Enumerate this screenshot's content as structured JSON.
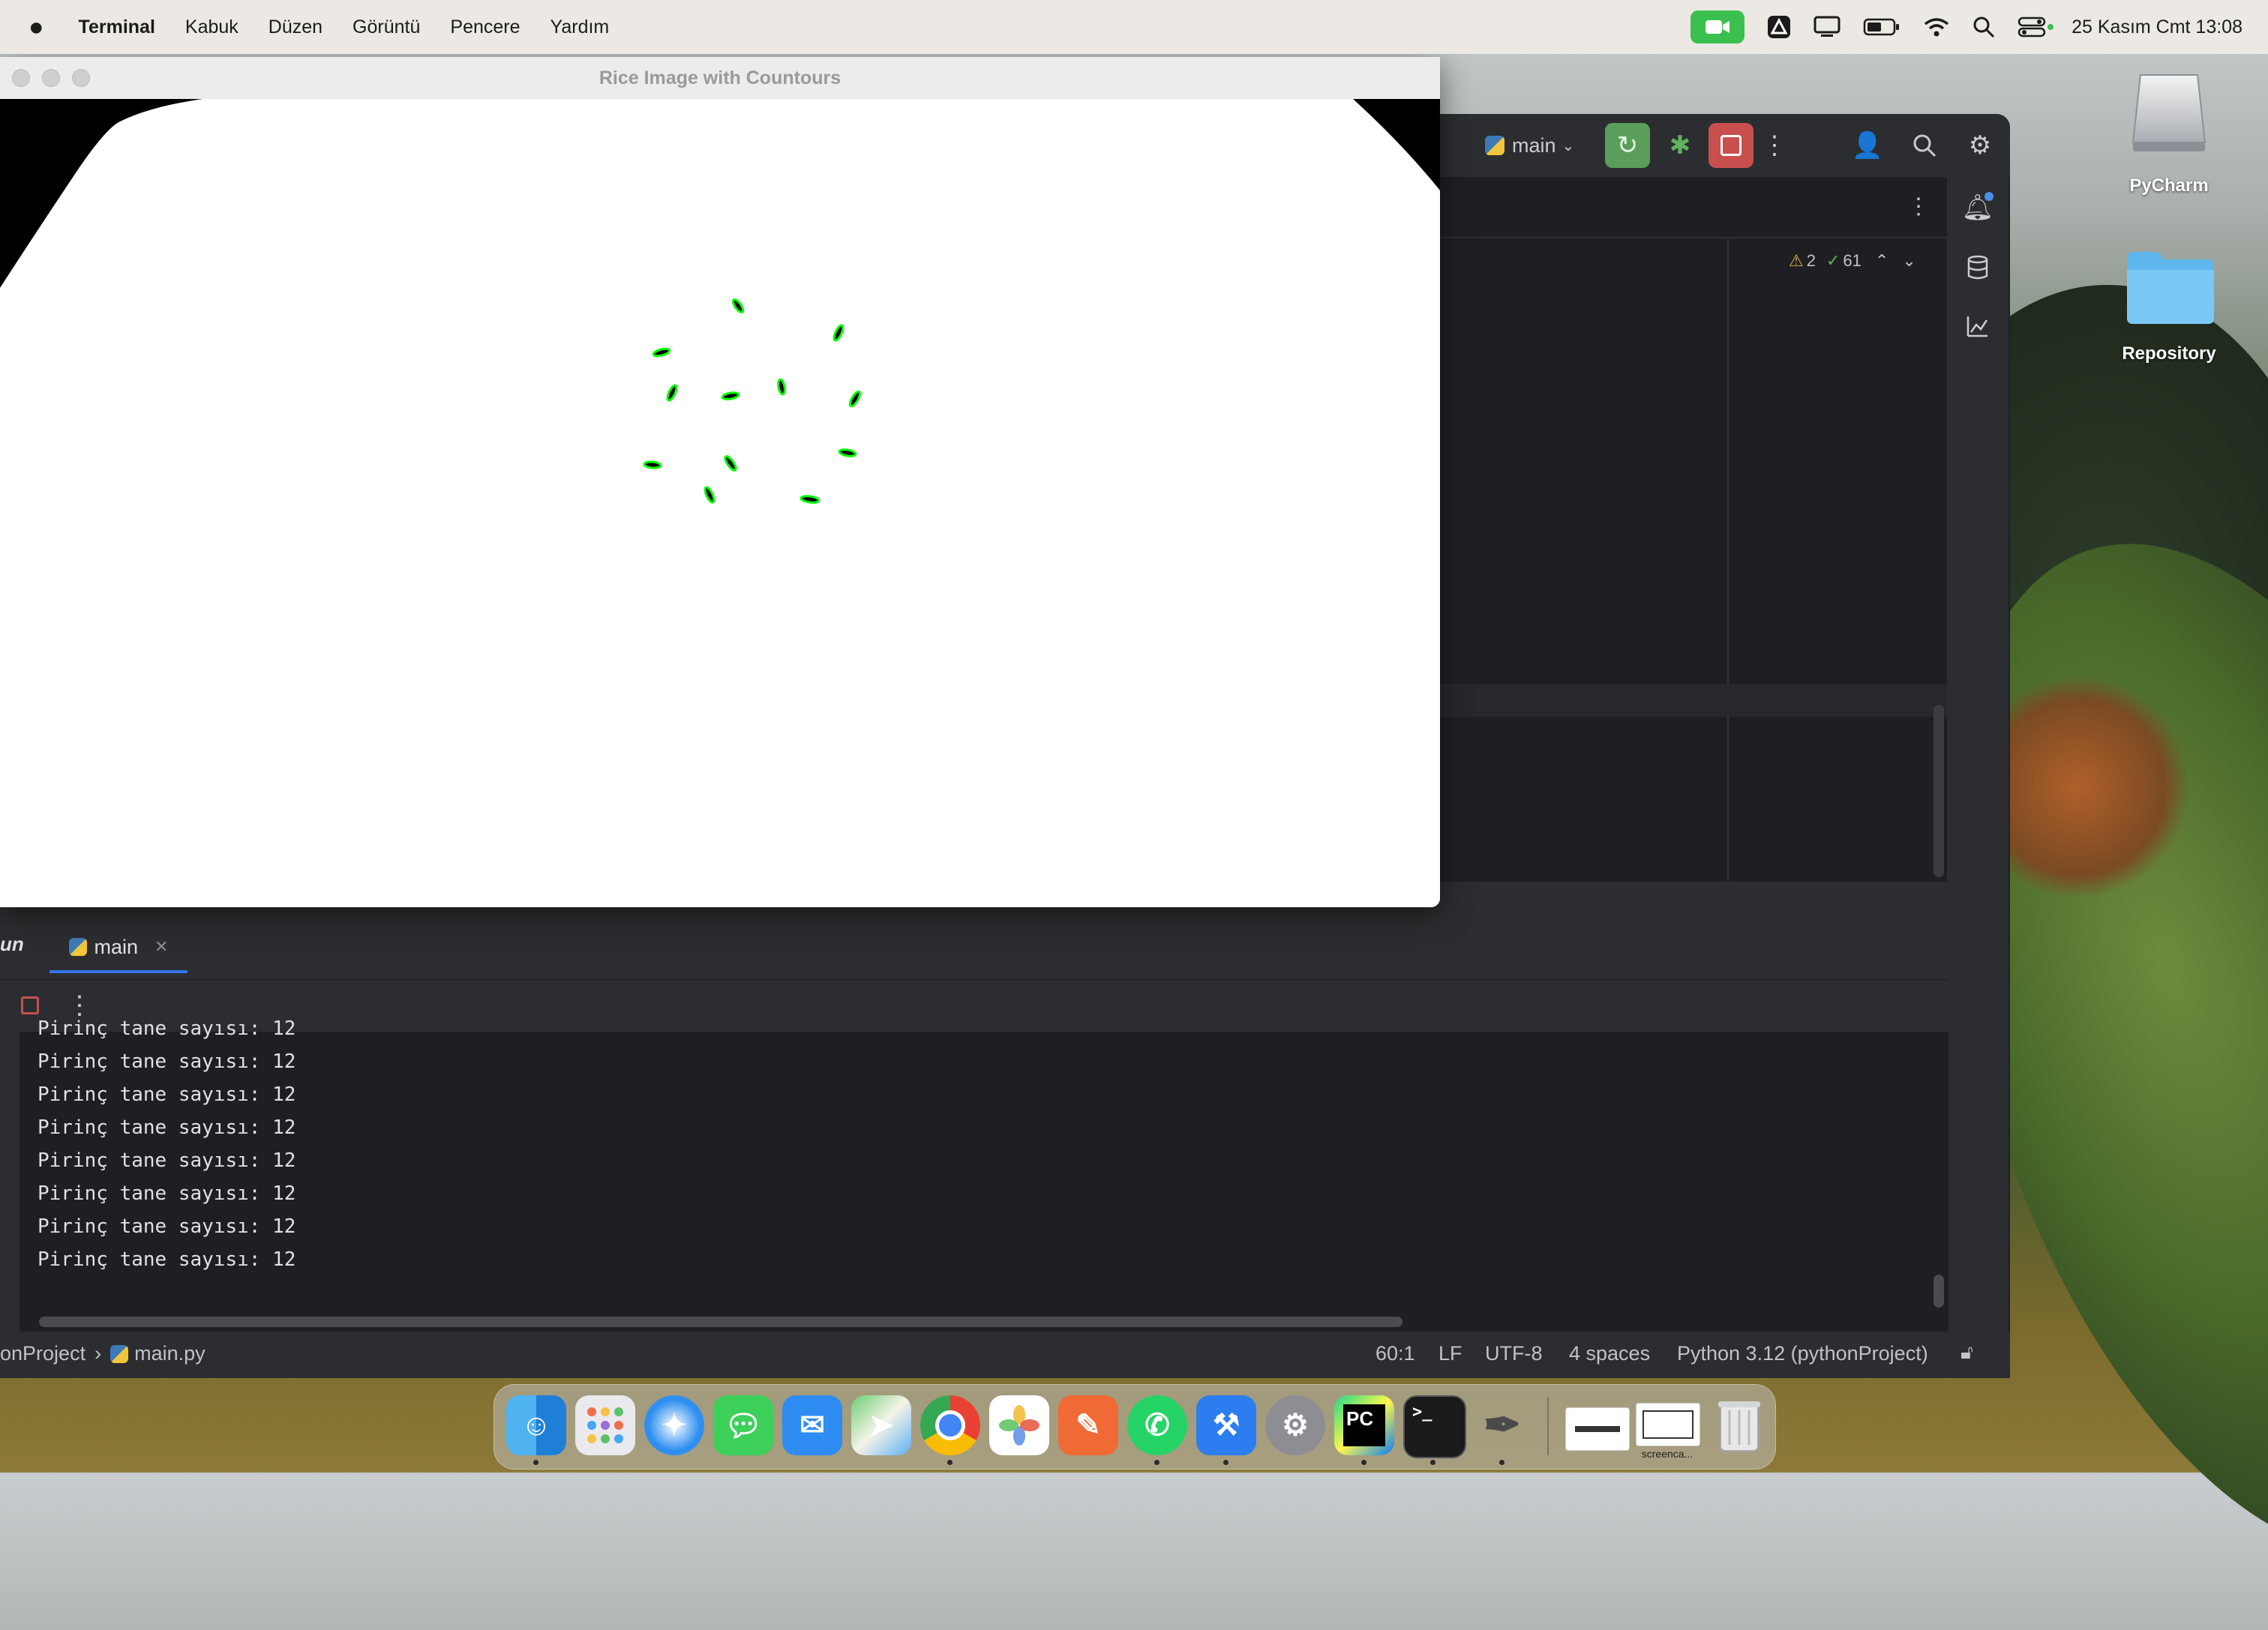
{
  "menubar": {
    "app_name": "Terminal",
    "items": [
      "Kabuk",
      "Düzen",
      "Görüntü",
      "Pencere",
      "Yardım"
    ],
    "datetime": "25 Kasım Cmt  13:08"
  },
  "rice_window": {
    "title": "Rice Image with Countours"
  },
  "pycharm": {
    "branch": "main",
    "warnings": "2",
    "ok_count": "61",
    "run_label": "Run",
    "run_tab": "main",
    "console_lines": [
      "Pirinç tane sayısı: 12",
      "Pirinç tane sayısı: 12",
      "Pirinç tane sayısı: 12",
      "Pirinç tane sayısı: 12",
      "Pirinç tane sayısı: 12",
      "Pirinç tane sayısı: 12",
      "Pirinç tane sayısı: 12",
      "Pirinç tane sayısı: 12"
    ],
    "status": {
      "project": "onProject",
      "file": "main.py",
      "position": "60:1",
      "line_sep": "LF",
      "encoding": "UTF-8",
      "indent": "4 spaces",
      "interpreter": "Python 3.12 (pythonProject)"
    }
  },
  "desktop": {
    "icons": [
      "PyCharm",
      "Repository"
    ]
  },
  "dock": {
    "items": [
      "Finder",
      "Launchpad",
      "Safari",
      "Messages",
      "Mail",
      "Maps",
      "Chrome",
      "Photos",
      "Pencil",
      "WhatsApp",
      "Xcode",
      "System Settings",
      "PyCharm",
      "Terminal",
      "Vector",
      "screenshot-1",
      "screencast",
      "Trash"
    ],
    "thumbnail_label": "screenca..."
  },
  "colors": {
    "facetime_green": "#3bbf4f",
    "contour_green": "#00ff00",
    "stop_red": "#c94f4f",
    "run_green": "#5a9e5a"
  }
}
